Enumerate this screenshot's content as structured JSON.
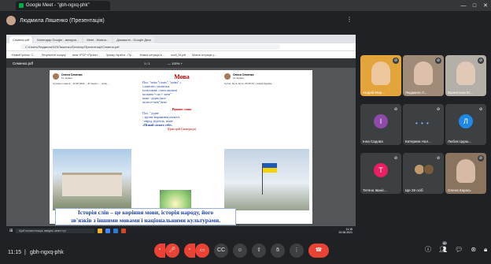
{
  "browser": {
    "tab_title": "Google Meet - \"gbh-ngxq-phk\"",
    "window_controls": [
      "—",
      "□",
      "✕"
    ]
  },
  "presenter": {
    "label": "Людмила Ляшенко (Презентація)"
  },
  "shared_screen": {
    "tabs": [
      "Семена.pdf",
      "Календар Google - вихідна...",
      "Meet - Мовна...",
      "Домашня - Google Диск"
    ],
    "address": "C:/Users/Людмила%20Ляшенко/Desktop/Презентації/Семена.pdf",
    "bookmarks": [
      "«Новий Ірпень: С...",
      "Результати пошуку",
      "Ізюм УРСР «Проект...",
      "Зранку Україна - Пр...",
      "Мовна ситуація в...",
      "rundi_34.pdf",
      "Мовна ситуація у..."
    ],
    "viewer": {
      "filename": "Семенко.pdf",
      "page": "1 / 1",
      "zoom": "— 100% +"
    },
    "page_content": {
      "left_post": {
        "name": "Олеся Семенко",
        "meta": "11 червня ·",
        "text": "Сучасні слова в... 12.06.2021 ... В ґанках і ... мову; ..."
      },
      "center": {
        "heading": "Мова",
        "lines": [
          "Пол. \"мо̄ва \"слово\", \"мо̄ви\" «",
          "словесне» молитися",
          "(освітлюва. стати чистим)",
          "молитва = мо + лити\"",
          "мова - рідна (мол-",
          "молесо=мо̄в\")зове"
        ],
        "subheading": "Рідннеє слово",
        "sub_lines": [
          "Пол. \" рідне",
          "- зручне вираження понятті,",
          "- народ, рідність, наше",
          "«Пізнай самого себе»",
          "(Григорій Сковорода)"
        ]
      },
      "right_post": {
        "name": "Олеся Семенко",
        "meta": "11 червня ·",
        "text": "Сучас. Бути. Бути. 25.05.21 - мовна будова; ..."
      },
      "banner": {
        "line1": "Історія слів – це коріння мови, історія народу, його",
        "line2": "зв'язків з іншими мовами і національними культурами."
      }
    },
    "taskbar": {
      "search_placeholder": "Щоб почати пошук, введіть запит тут",
      "time": "11:15",
      "date": "22.06.2021"
    }
  },
  "participants": [
    {
      "name": "Андрій Мир...",
      "kind": "video",
      "bg": "#e3a43b"
    },
    {
      "name": "Людмила Л...",
      "kind": "video",
      "bg": "#a08a78"
    },
    {
      "name": "Валентина Ю...",
      "kind": "video",
      "bg": "#b4b0a8"
    },
    {
      "name": "Інна Садова",
      "kind": "letter",
      "letter": "І",
      "color": "#8e4aa8"
    },
    {
      "name": "Катерина Нал...",
      "kind": "dots"
    },
    {
      "name": "Любов Цкрш...",
      "kind": "letter",
      "letter": "Л",
      "color": "#1e88e5"
    },
    {
      "name": "Тетяна Іваніс...",
      "kind": "letter",
      "letter": "Т",
      "color": "#e91e63"
    },
    {
      "name": "Ще 29 осіб",
      "kind": "more"
    },
    {
      "name": "Олена Карась",
      "kind": "video",
      "bg": "#8a735f"
    }
  ],
  "bottom_bar": {
    "time": "11:15",
    "meeting_code": "gbh-ngxq-phk",
    "participant_count": "40"
  }
}
